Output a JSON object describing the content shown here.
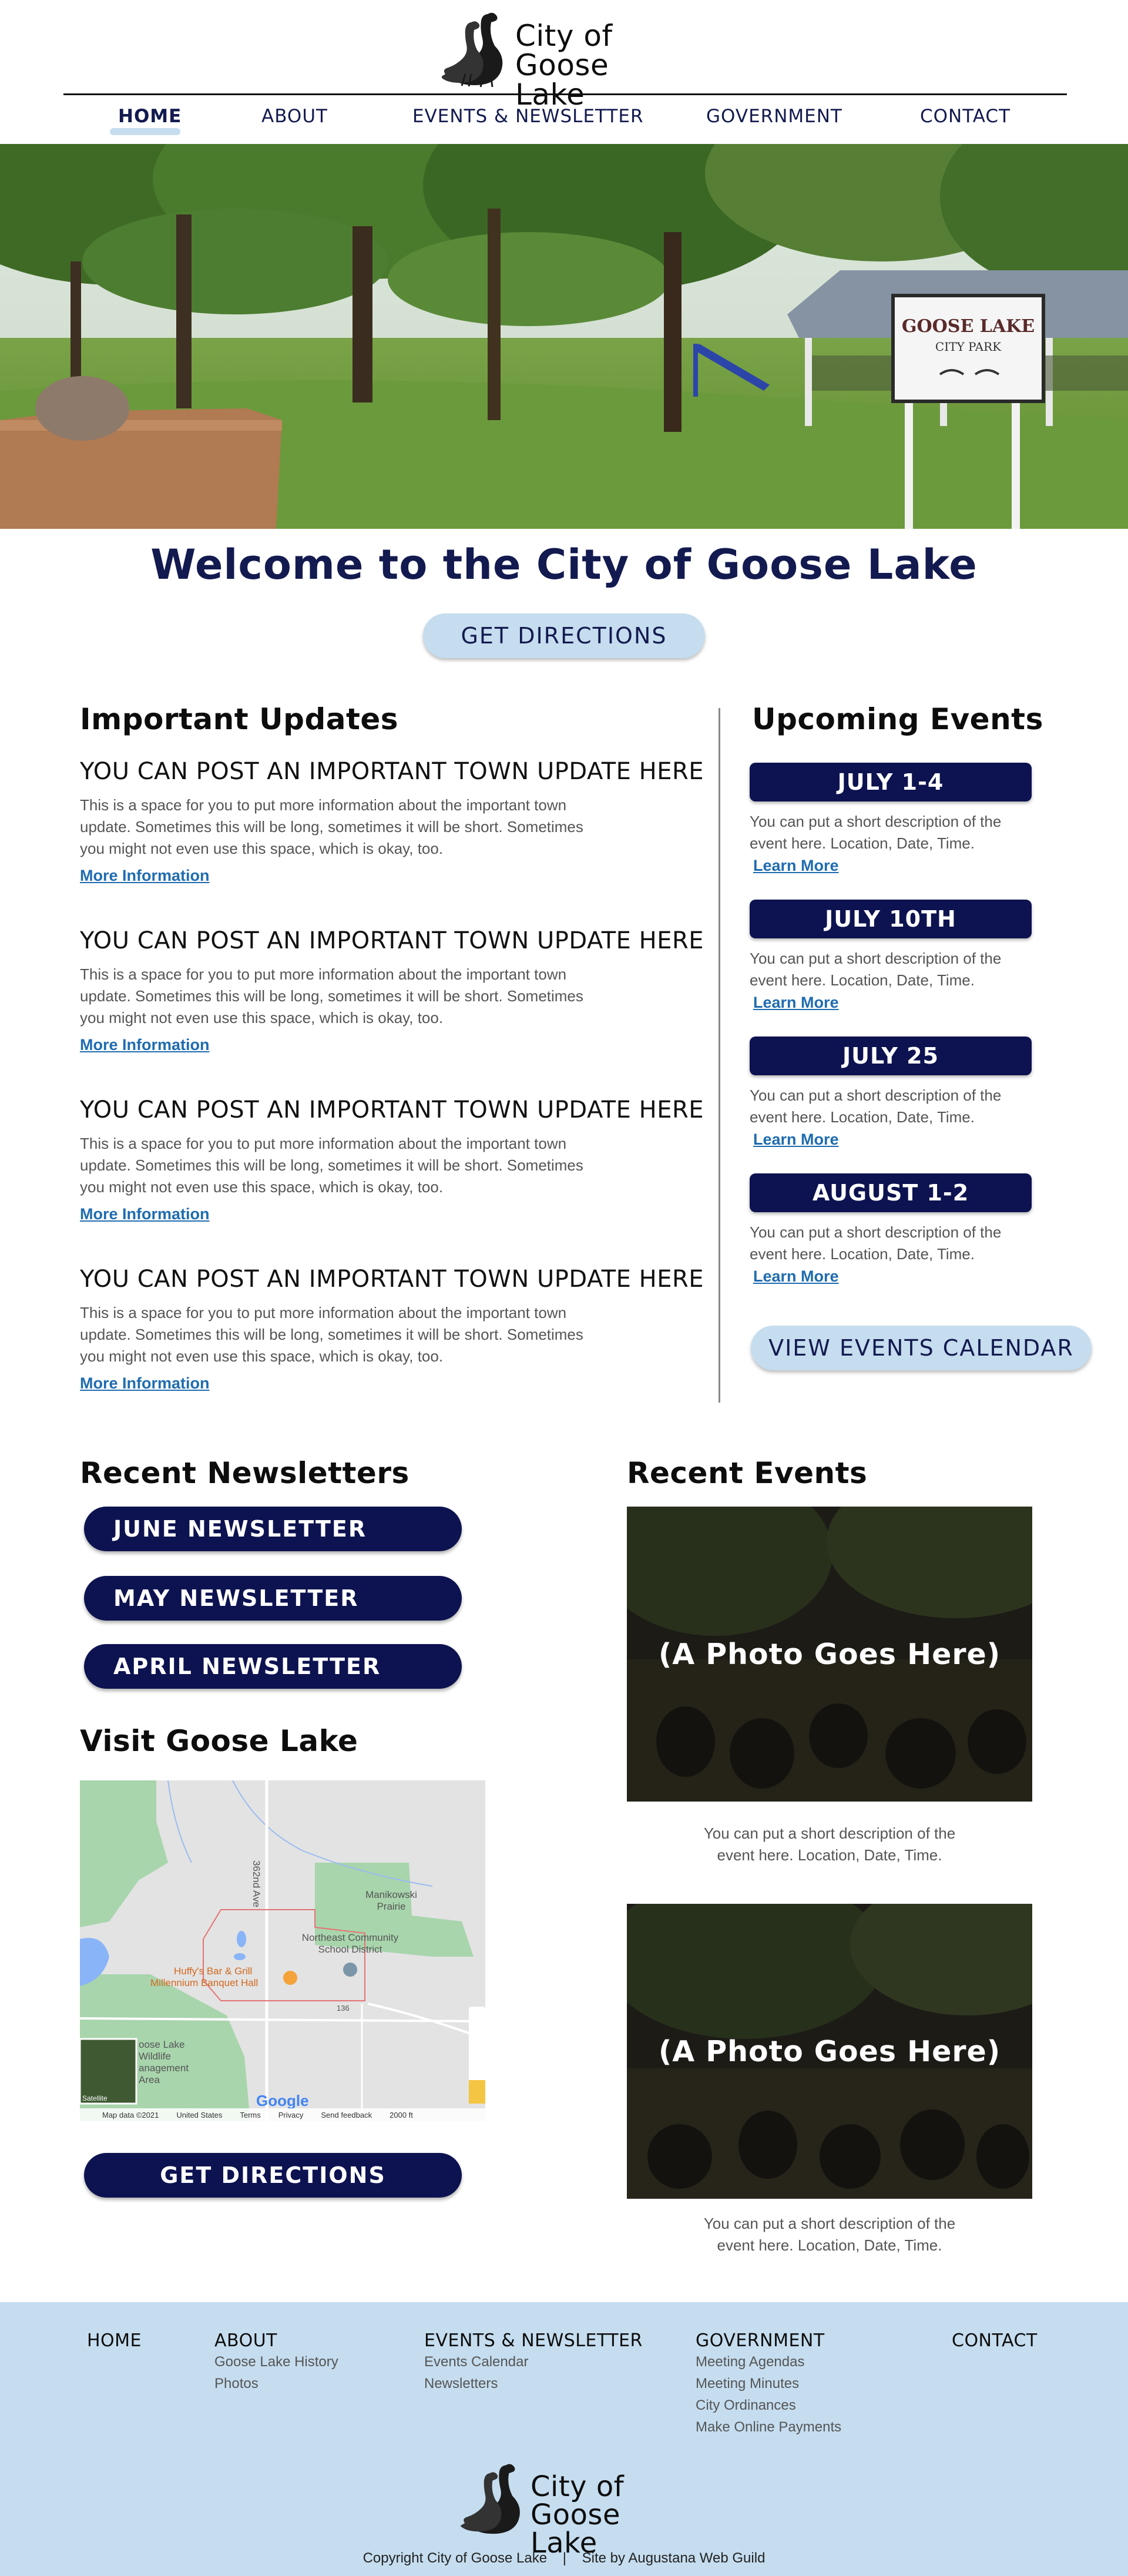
{
  "site": {
    "logo_line1": "City of",
    "logo_line2": "Goose Lake"
  },
  "nav": {
    "items": [
      {
        "label": "HOME",
        "active": true
      },
      {
        "label": "ABOUT"
      },
      {
        "label": "EVENTS & NEWSLETTER"
      },
      {
        "label": "GOVERNMENT"
      },
      {
        "label": "CONTACT"
      }
    ]
  },
  "hero": {
    "sign_line1": "GOOSE LAKE",
    "sign_line2": "CITY PARK"
  },
  "welcome": {
    "title": "Welcome to the City of Goose Lake",
    "directions_button": "GET DIRECTIONS"
  },
  "updates": {
    "heading": "Important Updates",
    "items": [
      {
        "title": "YOU CAN POST AN IMPORTANT TOWN UPDATE HERE",
        "body": "This is a space for you to put more information about the important town update. Sometimes this will be long, sometimes it will be short. Sometimes you might not even use this space, which is okay, too.",
        "link": "More Information"
      },
      {
        "title": "YOU CAN POST AN IMPORTANT TOWN UPDATE HERE",
        "body": "This is a space for you to put more information about the important town update. Sometimes this will be long, sometimes it will be short. Sometimes you might not even use this space, which is okay, too.",
        "link": "More Information"
      },
      {
        "title": "YOU CAN POST AN IMPORTANT TOWN UPDATE HERE",
        "body": "This is a space for you to put more information about the important town update. Sometimes this will be long, sometimes it will be short. Sometimes you might not even use this space, which is okay, too.",
        "link": "More Information"
      },
      {
        "title": "YOU CAN POST AN IMPORTANT TOWN UPDATE HERE",
        "body": "This is a space for you to put more information about the important town update. Sometimes this will be long, sometimes it will be short. Sometimes you might not even use this space, which is okay, too.",
        "link": "More Information"
      }
    ]
  },
  "events": {
    "heading": "Upcoming Events",
    "items": [
      {
        "date": "JULY 1-4",
        "desc": "You can put a short description of the event here. Location, Date, Time.",
        "link": "Learn More"
      },
      {
        "date": "JULY 10TH",
        "desc": "You can put a short description of the event here. Location, Date, Time.",
        "link": "Learn More"
      },
      {
        "date": "JULY 25",
        "desc": "You can put a short description of the event here. Location, Date, Time.",
        "link": "Learn More"
      },
      {
        "date": "AUGUST 1-2",
        "desc": "You can put a short description of the event here. Location, Date, Time.",
        "link": "Learn More"
      }
    ],
    "calendar_button": "VIEW EVENTS CALENDAR"
  },
  "newsletters": {
    "heading": "Recent Newsletters",
    "items": [
      "JUNE NEWSLETTER",
      "MAY NEWSLETTER",
      "APRIL NEWSLETTER"
    ]
  },
  "visit": {
    "heading": "Visit Goose Lake",
    "directions_button": "GET DIRECTIONS",
    "map": {
      "road_label": "362nd Ave",
      "place1": "Manikowski Prairie",
      "place2": "Northeast Community School District",
      "place3": "Huffy's Bar & Grill",
      "place4": "Millennium Banquet Hall",
      "place5": "oose Lake Wildlife anagement Area",
      "route": "136",
      "satellite": "Satellite",
      "google": "Google",
      "attribution": [
        "Map data ©2021",
        "United States",
        "Terms",
        "Privacy",
        "Send feedback",
        "2000 ft"
      ]
    }
  },
  "recent_events": {
    "heading": "Recent Events",
    "items": [
      {
        "photo_label": "(A Photo Goes Here)",
        "desc_line1": "You can put a short description of the",
        "desc_line2": "event here. Location, Date, Time."
      },
      {
        "photo_label": "(A Photo Goes Here)",
        "desc_line1": "You can put a short description of the",
        "desc_line2": "event here. Location, Date, Time."
      }
    ]
  },
  "footer": {
    "columns": [
      {
        "heading": "HOME",
        "items": []
      },
      {
        "heading": "ABOUT",
        "items": [
          "Goose Lake History",
          "Photos"
        ]
      },
      {
        "heading": "EVENTS & NEWSLETTER",
        "items": [
          "Events Calendar",
          "Newsletters"
        ]
      },
      {
        "heading": "GOVERNMENT",
        "items": [
          "Meeting Agendas",
          "Meeting Minutes",
          "City Ordinances",
          "Make Online Payments"
        ]
      },
      {
        "heading": "CONTACT",
        "items": []
      }
    ],
    "copyright": "Copyright City of Goose Lake",
    "separator": "|",
    "credit": "Site by Augustana Web Guild"
  },
  "colors": {
    "navy": "#0d1250",
    "light_blue": "#c5ddef",
    "link_blue": "#1f6cb0"
  }
}
